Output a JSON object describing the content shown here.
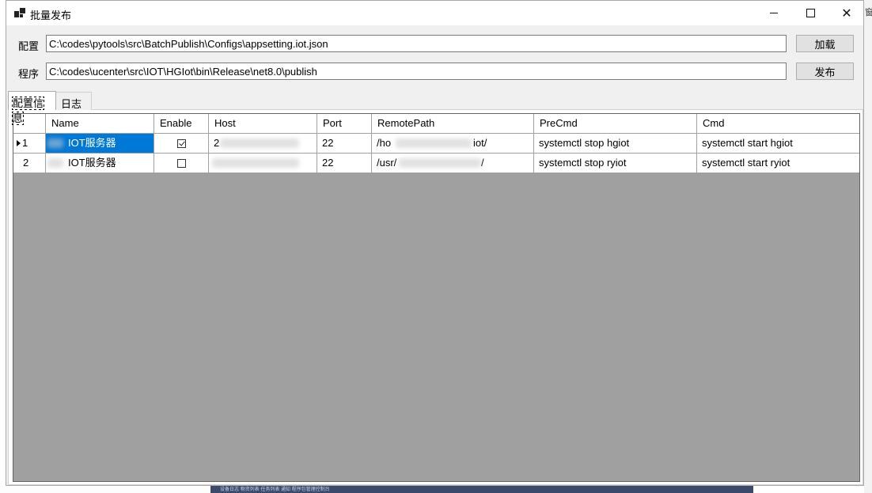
{
  "window": {
    "title": "批量发布"
  },
  "form": {
    "config_label": "配置",
    "config_value": "C:\\codes\\pytools\\src\\BatchPublish\\Configs\\appsetting.iot.json",
    "load_button": "加载",
    "program_label": "程序",
    "program_value": "C:\\codes\\ucenter\\src\\IOT\\HGIot\\bin\\Release\\net8.0\\publish",
    "publish_button": "发布"
  },
  "tabs": [
    {
      "label": "配置信息",
      "active": true
    },
    {
      "label": "日志",
      "active": false
    }
  ],
  "grid": {
    "columns": [
      "Name",
      "Enable",
      "Host",
      "Port",
      "RemotePath",
      "PreCmd",
      "Cmd"
    ],
    "rows": [
      {
        "index": "1",
        "current": true,
        "name": "IOT服务器",
        "enable": true,
        "host": "2",
        "port": "22",
        "remote_path": "/ho",
        "remote_path_tail": "iot/",
        "precmd": "systemctl stop hgiot",
        "cmd": "systemctl start hgiot"
      },
      {
        "index": "2",
        "current": false,
        "name": "IOT服务器",
        "enable": false,
        "host": "",
        "port": "22",
        "remote_path": "/usr/",
        "remote_path_tail": "/",
        "precmd": "systemctl stop ryiot",
        "cmd": "systemctl start ryiot"
      }
    ]
  },
  "background": {
    "edge_text": "窗",
    "taskbar_text": "设备日志  物资列表  任务列表  通知  程序包管理控制台"
  }
}
